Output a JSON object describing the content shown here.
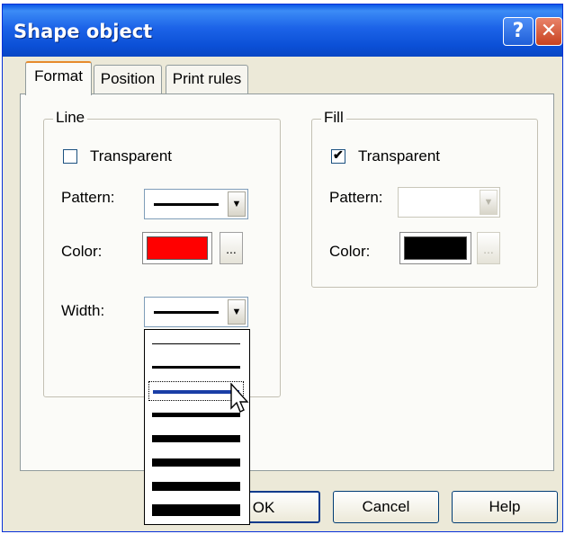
{
  "window": {
    "title": "Shape object",
    "help_glyph": "?",
    "close_glyph": "✕"
  },
  "tabs": [
    {
      "label": "Format",
      "active": true
    },
    {
      "label": "Position",
      "active": false
    },
    {
      "label": "Print rules",
      "active": false
    }
  ],
  "line_group": {
    "title": "Line",
    "transparent_label": "Transparent",
    "transparent_checked": false,
    "pattern_label": "Pattern:",
    "color_label": "Color:",
    "color_value": "#ff0000",
    "color_more": "...",
    "width_label": "Width:",
    "width_options_count": 8,
    "width_selected_index": 2
  },
  "fill_group": {
    "title": "Fill",
    "transparent_label": "Transparent",
    "transparent_checked": true,
    "check_glyph": "✔",
    "pattern_label": "Pattern:",
    "color_label": "Color:",
    "color_value": "#000000",
    "color_more": "..."
  },
  "buttons": {
    "ok": "OK",
    "cancel": "Cancel",
    "help": "Help"
  },
  "combo_arrow_glyph": "▼"
}
